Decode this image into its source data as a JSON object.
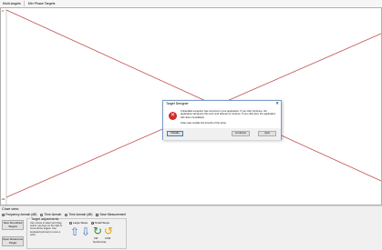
{
  "menu": {
    "items": [
      "Multi-targets",
      "Min Phase Targets"
    ]
  },
  "canvas": {
    "y_tick_top": "0",
    "y_tick_bottom": "-40",
    "line_color": "#c0504d"
  },
  "chart_view": {
    "title": "Chart view:",
    "options": [
      {
        "label": "Frequency domain (dB)",
        "selected": true
      },
      {
        "label": "Time domain",
        "selected": false
      },
      {
        "label": "Time domain (dB)",
        "selected": false
      }
    ],
    "checkbox_label": "Save Measurement"
  },
  "buttons": {
    "new_smoothed": "New Smoothed Targets",
    "open_reference": "Open Reference Target"
  },
  "target_adjustments": {
    "title": "Target adjustments",
    "description": "Use mouse to select and drag points, use keys on the right to move all the targets. Use keyboard (arrows) to move a point.",
    "large_steps": "Large Steps",
    "small_steps": "Small Steps",
    "arrow_up": "⇧",
    "arrow_down": "⇩",
    "rot_cw": "↻",
    "rot_ccw": "↺",
    "rot_cw_label": "CW",
    "rot_ccw_label": "CCW",
    "undo_label": "Set all curves"
  },
  "dialog": {
    "title": "Target Designer",
    "close_glyph": "✕",
    "icon_glyph": "✕",
    "message": "Unhandled exception has occurred in your application. If you click Continue, the application will ignore this error and attempt to continue. If you click Quit, the application will close immediately.",
    "detail": "Index was outside the bounds of the array.",
    "buttons": {
      "details": "Details",
      "continue": "Continue",
      "quit": "Quit"
    }
  }
}
